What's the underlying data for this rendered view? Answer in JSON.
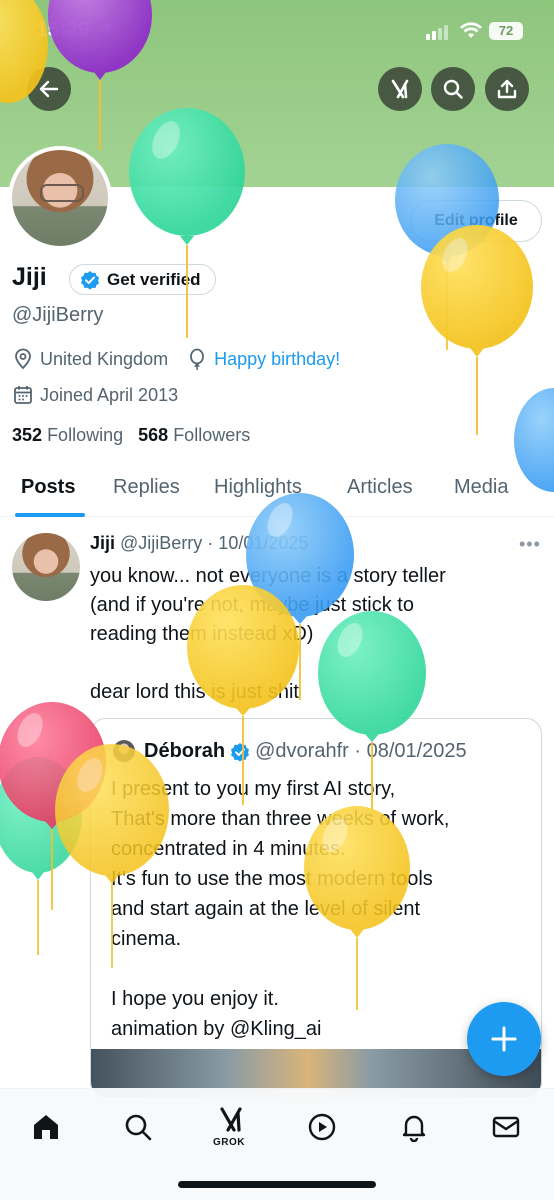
{
  "status_bar": {
    "time": "15:29",
    "battery": "72"
  },
  "profile": {
    "edit_label": "Edit profile",
    "name": "Jiji",
    "get_verified": "Get verified",
    "handle": "@JijiBerry",
    "location": "United Kingdom",
    "birthday": "Happy birthday!",
    "joined": "Joined April 2013",
    "following_count": "352",
    "following_label": "Following",
    "followers_count": "568",
    "followers_label": "Followers"
  },
  "tabs": [
    "Posts",
    "Replies",
    "Highlights",
    "Articles",
    "Media"
  ],
  "post": {
    "name": "Jiji",
    "meta": "@JijiBerry · 10/01/2025",
    "text": "you know... not everyone is a story teller\n(and if you're not, maybe just stick to\nreading them instead xD)\n\ndear lord this is just shit",
    "quote": {
      "name": "Déborah",
      "meta": "@dvorahfr · 08/01/2025",
      "text": "I present to you my first  AI story,\nThat's more than three weeks of work,\nconcentrated in 4 minutes.\nIt's fun to use the most modern tools\nand start again at the level of silent\ncinema.\n\n I hope you enjoy it.\n animation by @Kling_ai"
    }
  },
  "bottom_nav": {
    "grok_label": "GROK"
  },
  "colors": {
    "accent": "#1d9bf0",
    "banner": "#97cb87"
  },
  "icons": [
    "back-arrow-icon",
    "grok-icon",
    "search-icon",
    "share-icon",
    "verified-badge-icon",
    "location-icon",
    "birthday-balloon-icon",
    "calendar-icon",
    "compose-plus-icon",
    "home-icon",
    "video-icon",
    "bell-icon",
    "mail-icon"
  ]
}
